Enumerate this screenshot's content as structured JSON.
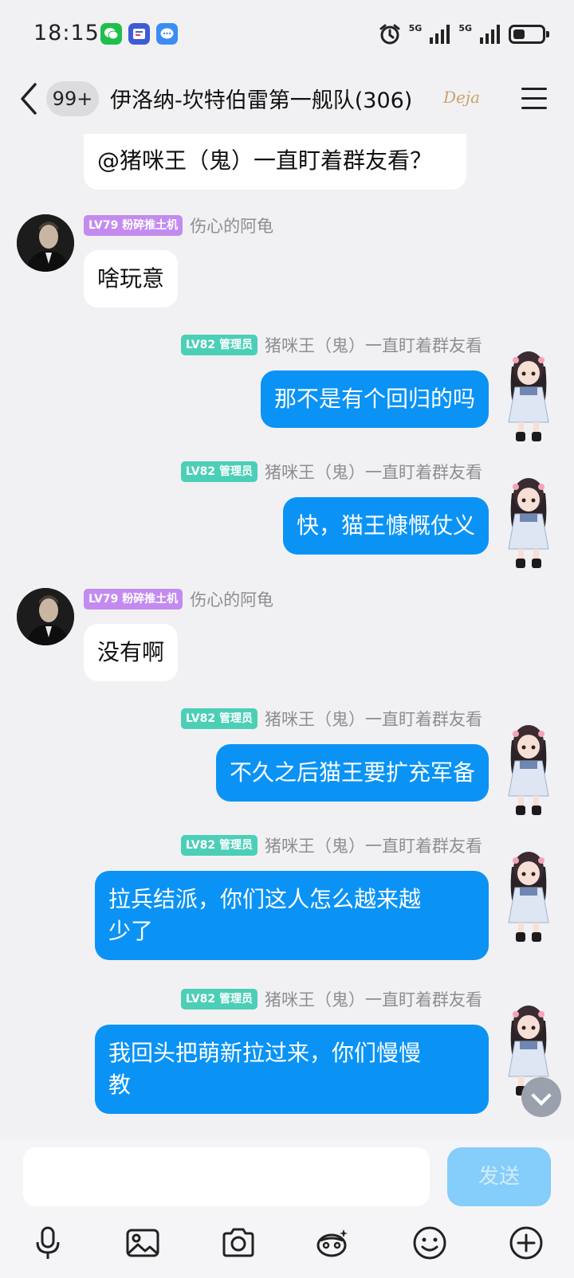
{
  "status_bar": {
    "time": "18:15",
    "network_1": "5G",
    "network_2": "5G",
    "battery_level": 0.4,
    "notification_icons": [
      "wechat-icon",
      "tieba-icon",
      "message-icon"
    ],
    "alarm_icon": "alarm-icon"
  },
  "header": {
    "unread_count": "99+",
    "title": "伊洛纳-坎特伯雷第一舰队(306)",
    "badge_text": "Deja"
  },
  "messages": [
    {
      "side": "in",
      "text": "@猪咪王（鬼）一直盯着群友看？",
      "partial": true
    },
    {
      "side": "in",
      "level": "LV79",
      "role": "粉碎推土机",
      "nickname": "伤心的阿龟",
      "text": "啥玩意"
    },
    {
      "side": "out",
      "level": "LV82",
      "role": "管理员",
      "nickname": "猪咪王（鬼）一直盯着群友看",
      "text": "那不是有个回归的吗"
    },
    {
      "side": "out",
      "level": "LV82",
      "role": "管理员",
      "nickname": "猪咪王（鬼）一直盯着群友看",
      "text": "快，猫王慷慨仗义"
    },
    {
      "side": "in",
      "level": "LV79",
      "role": "粉碎推土机",
      "nickname": "伤心的阿龟",
      "text": "没有啊"
    },
    {
      "side": "out",
      "level": "LV82",
      "role": "管理员",
      "nickname": "猪咪王（鬼）一直盯着群友看",
      "text": "不久之后猫王要扩充军备"
    },
    {
      "side": "out",
      "level": "LV82",
      "role": "管理员",
      "nickname": "猪咪王（鬼）一直盯着群友看",
      "text_lines": [
        "拉兵结派，你们这人怎么越来越",
        "少了"
      ]
    },
    {
      "side": "out",
      "level": "LV82",
      "role": "管理员",
      "nickname": "猪咪王（鬼）一直盯着群友看",
      "text_lines": [
        "我回头把萌新拉过来，你们慢慢",
        "教"
      ]
    }
  ],
  "input": {
    "placeholder": "",
    "send_label": "发送"
  },
  "toolbar": [
    "microphone-icon",
    "image-icon",
    "camera-icon",
    "emoji-hat-icon",
    "smiley-icon",
    "plus-icon"
  ],
  "colors": {
    "background": "#f1f1f3",
    "bubble_out": "#0a93f5",
    "bubble_in": "#ffffff",
    "level_purple": "#c38bf0",
    "level_teal": "#4ccfb7",
    "send_disabled": "#85cdfa"
  }
}
